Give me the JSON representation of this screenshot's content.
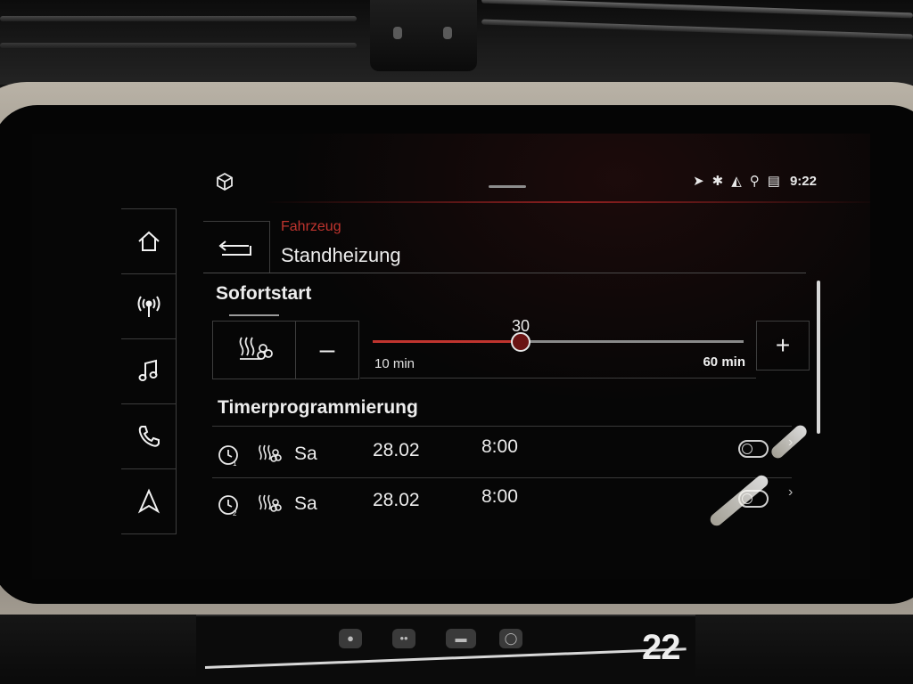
{
  "status_bar": {
    "car_icon": "car-cube-icon",
    "icons": [
      "navigation-arrow-icon",
      "bluetooth-icon",
      "speaker-mute-icon",
      "network-tree-icon",
      "signal-icon"
    ],
    "time": "9:22"
  },
  "nav_rail": [
    {
      "icon": "home-icon",
      "label": "Home"
    },
    {
      "icon": "radio-icon",
      "label": "Radio"
    },
    {
      "icon": "music-note-icon",
      "label": "Media"
    },
    {
      "icon": "phone-icon",
      "label": "Telefon"
    },
    {
      "icon": "navigation-icon",
      "label": "Navigation"
    }
  ],
  "header": {
    "breadcrumb": "Fahrzeug",
    "title": "Standheizung",
    "back_icon": "back-arrow-icon"
  },
  "sofortstart": {
    "title": "Sofortstart",
    "heater_icon": "seat-heater-icon",
    "minus_label": "–",
    "plus_label": "+",
    "value": "30",
    "min_label": "10 min",
    "max_label": "60 min",
    "min": 10,
    "max": 60,
    "current": 30
  },
  "timer": {
    "title": "Timerprogrammierung",
    "rows": [
      {
        "clock_icon": "timer-1-icon",
        "heater_icon": "heater-icon",
        "day": "Sa",
        "date": "28.02",
        "time": "8:00",
        "toggle_icon": "toggle-off-icon",
        "chevron": "›"
      },
      {
        "clock_icon": "timer-2-icon",
        "heater_icon": "heater-icon",
        "day": "Sa",
        "date": "28.02",
        "time": "8:00",
        "toggle_icon": "toggle-off-icon",
        "chevron": "›"
      }
    ]
  },
  "climate": {
    "temperature": "22"
  },
  "colors": {
    "accent_red": "#c0342e",
    "background": "#060606",
    "text": "#ededed"
  }
}
